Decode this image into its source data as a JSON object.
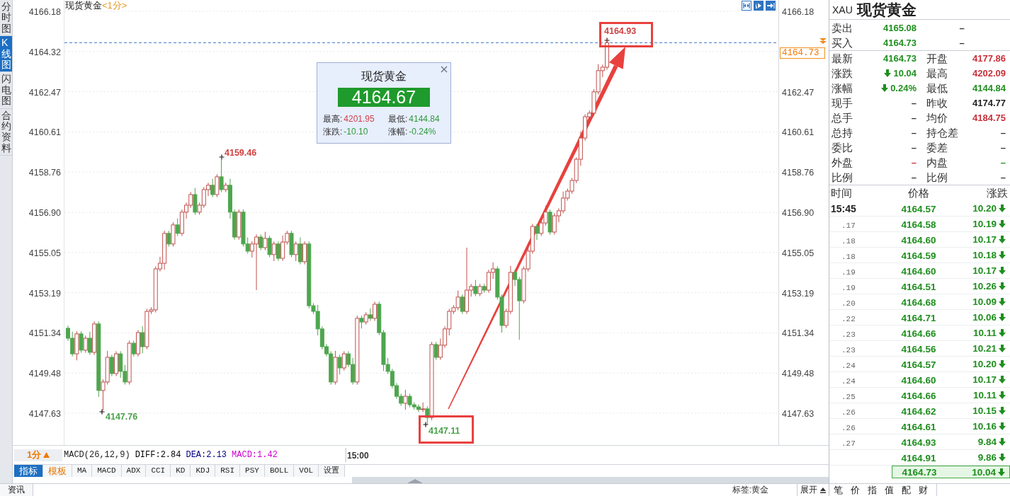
{
  "side_tabs": [
    {
      "label": "分时图",
      "selected": false
    },
    {
      "label": "K线图",
      "selected": true
    },
    {
      "label": "闪电图",
      "selected": false
    },
    {
      "label": "合约资料",
      "selected": false
    }
  ],
  "chart": {
    "title": "现货黄金",
    "period": "<1分>",
    "chart_data": {
      "type": "candlestick",
      "categories": [
        null,
        null,
        null,
        null,
        null,
        null,
        null,
        null,
        null,
        null,
        null,
        null,
        null,
        null,
        null,
        null,
        null,
        null,
        null,
        null,
        null,
        null,
        null,
        null,
        null,
        null,
        null,
        null,
        null,
        null,
        null,
        null,
        null,
        null,
        null,
        null,
        null,
        null,
        null,
        null,
        null,
        null,
        null,
        null,
        null,
        null,
        null,
        null,
        null,
        null,
        null,
        null,
        null,
        null,
        null,
        null,
        null,
        null,
        null,
        null,
        null,
        null,
        null,
        null,
        null,
        null,
        "15:00",
        null,
        null,
        null,
        null,
        null,
        null,
        null,
        null,
        null,
        null,
        null,
        null,
        null,
        null,
        null,
        null,
        null,
        null,
        null,
        null,
        null,
        null,
        null,
        null,
        null,
        null,
        null,
        null,
        null,
        null,
        null,
        null,
        null,
        null,
        null,
        null,
        null,
        null,
        null,
        null,
        null,
        null,
        null,
        null,
        null,
        null,
        null,
        null,
        null,
        null,
        null,
        null,
        null,
        null,
        null,
        null,
        null
      ],
      "ylim": [
        4146.16,
        4166.7
      ],
      "grid": true,
      "yticks": [
        {
          "value": 4166.18,
          "label": "4166.18"
        },
        {
          "value": 4164.32,
          "label": "4164.32"
        },
        {
          "value": 4162.47,
          "label": "4162.47"
        },
        {
          "value": 4160.61,
          "label": "4160.61"
        },
        {
          "value": 4158.76,
          "label": "4158.76"
        },
        {
          "value": 4156.9,
          "label": "4156.90"
        },
        {
          "value": 4155.05,
          "label": "4155.05"
        },
        {
          "value": 4153.19,
          "label": "4153.19"
        },
        {
          "value": 4151.34,
          "label": "4151.34"
        },
        {
          "value": 4149.48,
          "label": "4149.48"
        },
        {
          "value": 4147.63,
          "label": "4147.63"
        }
      ],
      "ref_lines": [
        {
          "axis": "y",
          "value": 4164.73,
          "color": "#3a78c0"
        }
      ],
      "ohlc": [
        [
          4151.55,
          4151.67,
          4150.97,
          4151.09
        ],
        [
          4151.09,
          4151.39,
          4150.25,
          4150.37
        ],
        [
          4150.37,
          4151.41,
          4150.07,
          4151.29
        ],
        [
          4151.29,
          4151.41,
          4150.42,
          4150.54
        ],
        [
          4150.54,
          4151.21,
          4150.42,
          4151.09
        ],
        [
          4151.09,
          4151.39,
          4150.32,
          4150.44
        ],
        [
          4150.44,
          4151.87,
          4150.32,
          4151.75
        ],
        [
          4151.75,
          4151.87,
          4148.38,
          4148.68
        ],
        [
          4148.68,
          4149.19,
          4147.76,
          4149.07
        ],
        [
          4149.07,
          4150.51,
          4148.95,
          4150.21
        ],
        [
          4150.21,
          4150.33,
          4149.34,
          4149.46
        ],
        [
          4149.46,
          4150.49,
          4149.34,
          4150.37
        ],
        [
          4150.37,
          4150.49,
          4149.26,
          4149.56
        ],
        [
          4149.56,
          4149.86,
          4148.95,
          4149.07
        ],
        [
          4149.07,
          4150.98,
          4148.95,
          4150.86
        ],
        [
          4150.86,
          4150.98,
          4150.25,
          4150.37
        ],
        [
          4150.37,
          4151.47,
          4150.25,
          4151.35
        ],
        [
          4151.35,
          4151.65,
          4150.4,
          4150.7
        ],
        [
          4150.7,
          4152.45,
          4150.58,
          4152.33
        ],
        [
          4152.33,
          4152.52,
          4152.21,
          4152.4
        ],
        [
          4152.4,
          4154.41,
          4152.28,
          4154.29
        ],
        [
          4154.29,
          4154.85,
          4154.17,
          4154.55
        ],
        [
          4154.55,
          4156.05,
          4154.25,
          4155.93
        ],
        [
          4155.93,
          4156.05,
          4155.32,
          4155.44
        ],
        [
          4155.44,
          4156.44,
          4155.32,
          4156.32
        ],
        [
          4156.32,
          4156.62,
          4155.81,
          4155.93
        ],
        [
          4155.93,
          4157.03,
          4155.81,
          4156.91
        ],
        [
          4156.91,
          4157.35,
          4156.61,
          4157.23
        ],
        [
          4157.23,
          4157.84,
          4157.11,
          4157.72
        ],
        [
          4157.72,
          4158.02,
          4156.79,
          4156.91
        ],
        [
          4156.91,
          4157.35,
          4156.79,
          4157.23
        ],
        [
          4157.23,
          4158.07,
          4157.11,
          4157.95
        ],
        [
          4157.95,
          4158.27,
          4157.65,
          4158.15
        ],
        [
          4158.15,
          4158.45,
          4157.6,
          4157.72
        ],
        [
          4157.72,
          4158.66,
          4157.6,
          4158.54
        ],
        [
          4158.54,
          4159.46,
          4157.83,
          4157.95
        ],
        [
          4157.95,
          4158.27,
          4157.83,
          4158.15
        ],
        [
          4158.15,
          4158.45,
          4156.61,
          4156.91
        ],
        [
          4156.91,
          4157.03,
          4155.64,
          4155.76
        ],
        [
          4155.76,
          4157.03,
          4155.64,
          4156.91
        ],
        [
          4156.91,
          4157.03,
          4155.32,
          4155.44
        ],
        [
          4155.44,
          4155.74,
          4154.99,
          4155.11
        ],
        [
          4155.11,
          4155.56,
          4154.81,
          4155.44
        ],
        [
          4155.44,
          4155.88,
          4153.31,
          4155.76
        ],
        [
          4155.76,
          4155.88,
          4155.15,
          4155.27
        ],
        [
          4155.27,
          4156,
          4155.15,
          4155.7
        ],
        [
          4155.7,
          4155.82,
          4154.83,
          4154.95
        ],
        [
          4154.95,
          4155.56,
          4154.65,
          4155.44
        ],
        [
          4155.44,
          4155.56,
          4154.66,
          4154.78
        ],
        [
          4154.78,
          4155.83,
          4154.66,
          4155.53
        ],
        [
          4155.53,
          4156.05,
          4155.41,
          4155.93
        ],
        [
          4155.93,
          4156.05,
          4154.83,
          4154.95
        ],
        [
          4154.95,
          4155.56,
          4154.65,
          4155.44
        ],
        [
          4155.44,
          4155.74,
          4154.5,
          4154.62
        ],
        [
          4154.62,
          4155.56,
          4154.5,
          4155.44
        ],
        [
          4155.44,
          4155.56,
          4152.47,
          4152.59
        ],
        [
          4152.59,
          4152.71,
          4152.21,
          4152.33
        ],
        [
          4152.33,
          4152.63,
          4151.22,
          4151.52
        ],
        [
          4151.52,
          4151.64,
          4150.58,
          4150.7
        ],
        [
          4150.7,
          4150.82,
          4150.25,
          4150.37
        ],
        [
          4150.37,
          4150.49,
          4148.95,
          4149.07
        ],
        [
          4149.07,
          4150.51,
          4148.95,
          4150.21
        ],
        [
          4150.21,
          4150.33,
          4149.42,
          4149.72
        ],
        [
          4149.72,
          4150.49,
          4149.6,
          4150.37
        ],
        [
          4150.37,
          4150.49,
          4149.76,
          4149.88
        ],
        [
          4149.88,
          4150.18,
          4148.95,
          4149.07
        ],
        [
          4149.07,
          4152.13,
          4148.95,
          4152.01
        ],
        [
          4152.01,
          4152.13,
          4151.54,
          4151.84
        ],
        [
          4151.84,
          4152.29,
          4151.72,
          4152.17
        ],
        [
          4152.17,
          4152.47,
          4151.89,
          4152.01
        ],
        [
          4152.01,
          4152.78,
          4151.89,
          4152.66
        ],
        [
          4152.66,
          4152.78,
          4151.23,
          4151.35
        ],
        [
          4151.35,
          4151.47,
          4149.58,
          4149.88
        ],
        [
          4149.88,
          4150.18,
          4149.44,
          4149.56
        ],
        [
          4149.56,
          4149.68,
          4148.78,
          4148.9
        ],
        [
          4148.9,
          4149.02,
          4148.29,
          4148.41
        ],
        [
          4148.41,
          4148.53,
          4147.97,
          4148.09
        ],
        [
          4148.09,
          4148.71,
          4147.79,
          4148.41
        ],
        [
          4148.41,
          4148.53,
          4147.9,
          4148.02
        ],
        [
          4148.02,
          4148.14,
          4147.8,
          4147.92
        ],
        [
          4147.92,
          4148.04,
          4147.68,
          4147.8
        ],
        [
          4147.8,
          4148.13,
          4147.68,
          4147.83
        ],
        [
          4147.83,
          4147.95,
          4147.11,
          4147.43
        ],
        [
          4147.43,
          4150.92,
          4147.31,
          4150.8
        ],
        [
          4150.8,
          4150.92,
          4150.09,
          4150.21
        ],
        [
          4150.21,
          4151.07,
          4150.09,
          4150.77
        ],
        [
          4150.77,
          4151.64,
          4150.65,
          4151.52
        ],
        [
          4151.52,
          4152.45,
          4151.22,
          4152.33
        ],
        [
          4152.33,
          4152.62,
          4152.21,
          4152.5
        ],
        [
          4152.5,
          4153.29,
          4152.38,
          4152.99
        ],
        [
          4152.99,
          4153.11,
          4152.21,
          4152.33
        ],
        [
          4152.33,
          4155.27,
          4152.21,
          4153.31
        ],
        [
          4153.31,
          4153.6,
          4153.01,
          4153.48
        ],
        [
          4153.48,
          4153.78,
          4153.03,
          4153.15
        ],
        [
          4153.15,
          4153.6,
          4153.03,
          4153.48
        ],
        [
          4153.48,
          4153.6,
          4153.19,
          4153.31
        ],
        [
          4153.31,
          4154.25,
          4153.19,
          4154.13
        ],
        [
          4154.13,
          4154.59,
          4153.83,
          4154.29
        ],
        [
          4154.29,
          4154.41,
          4152.87,
          4152.99
        ],
        [
          4152.99,
          4153.11,
          4151.35,
          4151.68
        ],
        [
          4151.68,
          4152.45,
          4151.56,
          4152.33
        ],
        [
          4152.33,
          4154.43,
          4152.21,
          4154.13
        ],
        [
          4154.13,
          4154.25,
          4153.5,
          4153.8
        ],
        [
          4153.8,
          4153.92,
          4151.02,
          4152.82
        ],
        [
          4152.82,
          4154.41,
          4152.7,
          4154.29
        ],
        [
          4154.29,
          4155.41,
          4154.17,
          4155.11
        ],
        [
          4155.11,
          4156.37,
          4154.99,
          4156.25
        ],
        [
          4156.25,
          4156.37,
          4155.63,
          4155.93
        ],
        [
          4155.93,
          4156.53,
          4155.81,
          4156.41
        ],
        [
          4156.41,
          4157.21,
          4156.29,
          4156.91
        ],
        [
          4156.91,
          4157.03,
          4155.87,
          4155.99
        ],
        [
          4155.99,
          4156.86,
          4155.87,
          4156.74
        ],
        [
          4156.74,
          4157.09,
          4156.44,
          4156.97
        ],
        [
          4156.97,
          4157.86,
          4156.85,
          4157.56
        ],
        [
          4157.56,
          4158,
          4157.44,
          4157.88
        ],
        [
          4157.88,
          4158.49,
          4157.76,
          4158.37
        ],
        [
          4158.37,
          4159.44,
          4158.25,
          4159.35
        ],
        [
          4159.35,
          4160.63,
          4159.05,
          4160.33
        ],
        [
          4160.33,
          4161.43,
          4160.21,
          4161.31
        ],
        [
          4161.31,
          4161.6,
          4161.19,
          4161.48
        ],
        [
          4161.48,
          4162.58,
          4161.36,
          4162.46
        ],
        [
          4162.46,
          4163.74,
          4162.34,
          4163.44
        ],
        [
          4163.44,
          4163.72,
          4163.14,
          4163.6
        ],
        [
          4163.6,
          4164.93,
          4163.48,
          4164.73
        ]
      ]
    },
    "right_axis": [
      {
        "kind": "tick",
        "label": "4166.18"
      },
      {
        "kind": "price_tag",
        "label": "4164.73"
      },
      {
        "kind": "tick",
        "label": "4162.47"
      },
      {
        "kind": "tick",
        "label": "4160.61"
      },
      {
        "kind": "tick",
        "label": "4158.76"
      },
      {
        "kind": "tick",
        "label": "4156.90"
      },
      {
        "kind": "tick",
        "label": "4155.05"
      },
      {
        "kind": "tick",
        "label": "4153.19"
      },
      {
        "kind": "tick",
        "label": "4151.34"
      },
      {
        "kind": "tick",
        "label": "4149.48"
      },
      {
        "kind": "tick",
        "label": "4147.63"
      }
    ],
    "extremes": [
      {
        "label": "4159.46",
        "kind": "high",
        "highlighted": false
      },
      {
        "label": "4147.76",
        "kind": "low",
        "highlighted": false
      },
      {
        "label": "4147.11",
        "kind": "low",
        "highlighted": true
      },
      {
        "label": "4164.93",
        "kind": "high",
        "highlighted": true
      }
    ],
    "tooltip": {
      "title": "现货黄金",
      "price": "4164.67",
      "falling": true,
      "stats": [
        {
          "label": "最高:",
          "value": "4201.95",
          "color": "#d0404a"
        },
        {
          "label": "最低:",
          "value": "4144.84",
          "color": "#2e9a3e"
        },
        {
          "label": "涨跌:",
          "value": "-10.10",
          "color": "#2e9a3e"
        },
        {
          "label": "涨幅:",
          "value": "-0.24%",
          "color": "#2e9a3e"
        }
      ]
    }
  },
  "macd": {
    "period": "1分",
    "title": "MACD(26,12,9)",
    "values": [
      {
        "label": "DIFF:2.84",
        "color": "#000000"
      },
      {
        "label": "DEA:2.13",
        "color": "#000080"
      },
      {
        "label": "MACD:1.42",
        "color": "#cc00cc"
      }
    ]
  },
  "indicator_tabs": [
    {
      "label": "指标",
      "kind": "tab",
      "selected": true
    },
    {
      "label": "模板",
      "kind": "menu",
      "selected": false
    },
    {
      "label": "MA",
      "kind": "indicator",
      "selected": false
    },
    {
      "label": "MACD",
      "kind": "indicator",
      "selected": false
    },
    {
      "label": "ADX",
      "kind": "indicator",
      "selected": false
    },
    {
      "label": "CCI",
      "kind": "indicator",
      "selected": false
    },
    {
      "label": "KD",
      "kind": "indicator",
      "selected": false
    },
    {
      "label": "KDJ",
      "kind": "indicator",
      "selected": false
    },
    {
      "label": "RSI",
      "kind": "indicator",
      "selected": false
    },
    {
      "label": "PSY",
      "kind": "indicator",
      "selected": false
    },
    {
      "label": "BOLL",
      "kind": "indicator",
      "selected": false
    },
    {
      "label": "VOL",
      "kind": "indicator",
      "selected": false
    },
    {
      "label": "设置",
      "kind": "indicator",
      "selected": false
    }
  ],
  "bottom_bar": {
    "tab": "资讯",
    "tag": "标签:黄金",
    "expand": "展开"
  },
  "quote": {
    "symbol": "XAU",
    "name": "现货黄金",
    "bid_ask": [
      {
        "label": "卖出",
        "value": "4165.08",
        "color": "#1e8f1e",
        "volume": "–"
      },
      {
        "label": "买入",
        "value": "4164.73",
        "color": "#1e8f1e",
        "volume": "–"
      }
    ],
    "stats": [
      {
        "left": {
          "label": "最新",
          "value": "4164.73",
          "color": "#1e8f1e",
          "arrow_down": false
        },
        "right": {
          "label": "开盘",
          "value": "4177.86",
          "color": "#c8313a",
          "arrow_down": false
        }
      },
      {
        "left": {
          "label": "涨跌",
          "value": "10.04",
          "color": "#1e8f1e",
          "arrow_down": true
        },
        "right": {
          "label": "最高",
          "value": "4202.09",
          "color": "#c8313a",
          "arrow_down": false
        }
      },
      {
        "left": {
          "label": "涨幅",
          "value": "0.24%",
          "color": "#1e8f1e",
          "arrow_down": true
        },
        "right": {
          "label": "最低",
          "value": "4144.84",
          "color": "#1e8f1e",
          "arrow_down": false
        }
      },
      {
        "left": {
          "label": "现手",
          "value": "–",
          "color": "#333333",
          "arrow_down": false
        },
        "right": {
          "label": "昨收",
          "value": "4174.77",
          "color": "#222222",
          "arrow_down": false
        }
      },
      {
        "left": {
          "label": "总手",
          "value": "–",
          "color": "#333333",
          "arrow_down": false
        },
        "right": {
          "label": "均价",
          "value": "4184.75",
          "color": "#c8313a",
          "arrow_down": false
        }
      },
      {
        "left": {
          "label": "总持",
          "value": "–",
          "color": "#333333",
          "arrow_down": false
        },
        "right": {
          "label": "持仓差",
          "value": "–",
          "color": "#333333",
          "arrow_down": false
        }
      },
      {
        "left": {
          "label": "委比",
          "value": "–",
          "color": "#333333",
          "arrow_down": false
        },
        "right": {
          "label": "委差",
          "value": "–",
          "color": "#333333",
          "arrow_down": false
        }
      },
      {
        "left": {
          "label": "外盘",
          "value": "–",
          "color": "#c8313a",
          "arrow_down": false
        },
        "right": {
          "label": "内盘",
          "value": "–",
          "color": "#1e8f1e",
          "arrow_down": false
        }
      },
      {
        "left": {
          "label": "比例",
          "value": "–",
          "color": "#333333",
          "arrow_down": false
        },
        "right": {
          "label": "比例",
          "value": "–",
          "color": "#333333",
          "arrow_down": false
        }
      }
    ],
    "trades": {
      "columns": [
        "时间",
        "价格",
        "涨跌"
      ],
      "rows": [
        {
          "time": "15:45",
          "kind": "minute",
          "price": "4164.57",
          "change": "10.20",
          "falling": true,
          "selected": false
        },
        {
          "time": ".17",
          "kind": "second",
          "price": "4164.58",
          "change": "10.19",
          "falling": true,
          "selected": false
        },
        {
          "time": ".18",
          "kind": "second",
          "price": "4164.60",
          "change": "10.17",
          "falling": true,
          "selected": false
        },
        {
          "time": ".18",
          "kind": "second",
          "price": "4164.59",
          "change": "10.18",
          "falling": true,
          "selected": false
        },
        {
          "time": ".19",
          "kind": "second",
          "price": "4164.60",
          "change": "10.17",
          "falling": true,
          "selected": false
        },
        {
          "time": ".19",
          "kind": "second",
          "price": "4164.51",
          "change": "10.26",
          "falling": true,
          "selected": false
        },
        {
          "time": ".20",
          "kind": "second",
          "price": "4164.68",
          "change": "10.09",
          "falling": true,
          "selected": false
        },
        {
          "time": ".22",
          "kind": "second",
          "price": "4164.71",
          "change": "10.06",
          "falling": true,
          "selected": false
        },
        {
          "time": ".23",
          "kind": "second",
          "price": "4164.66",
          "change": "10.11",
          "falling": true,
          "selected": false
        },
        {
          "time": ".23",
          "kind": "second",
          "price": "4164.56",
          "change": "10.21",
          "falling": true,
          "selected": false
        },
        {
          "time": ".24",
          "kind": "second",
          "price": "4164.57",
          "change": "10.20",
          "falling": true,
          "selected": false
        },
        {
          "time": ".24",
          "kind": "second",
          "price": "4164.60",
          "change": "10.17",
          "falling": true,
          "selected": false
        },
        {
          "time": ".25",
          "kind": "second",
          "price": "4164.66",
          "change": "10.11",
          "falling": true,
          "selected": false
        },
        {
          "time": ".26",
          "kind": "second",
          "price": "4164.62",
          "change": "10.15",
          "falling": true,
          "selected": false
        },
        {
          "time": ".26",
          "kind": "second",
          "price": "4164.61",
          "change": "10.16",
          "falling": true,
          "selected": false
        },
        {
          "time": ".27",
          "kind": "second",
          "price": "4164.93",
          "change": "9.84",
          "falling": true,
          "selected": false
        },
        {
          "price": "4164.91",
          "change": "9.86",
          "falling": true,
          "selected": false
        },
        {
          "price": "4164.73",
          "change": "10.04",
          "falling": true,
          "selected": true
        }
      ]
    },
    "tabs": [
      "笔",
      "价",
      "指",
      "值",
      "配",
      "财"
    ]
  }
}
